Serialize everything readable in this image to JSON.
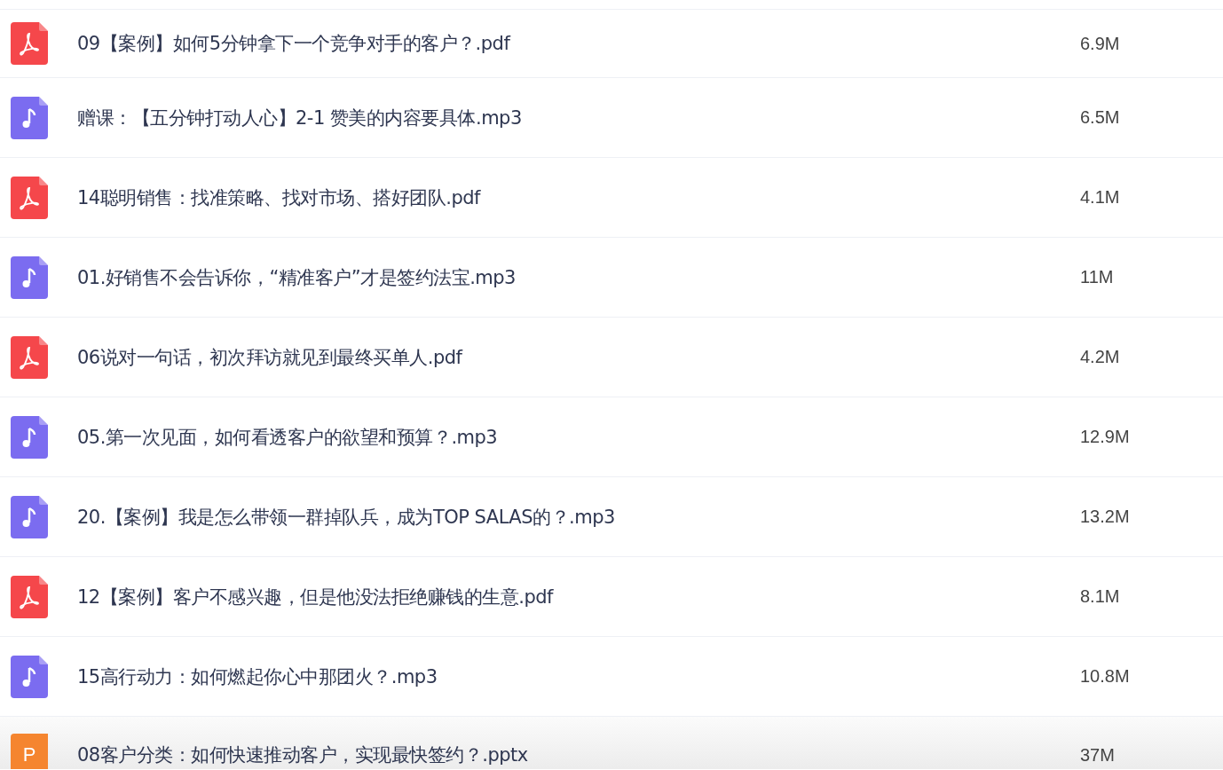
{
  "files": [
    {
      "kind": "pdf",
      "name": "09【案例】如何5分钟拿下一个竞争对手的客户？.pdf",
      "size": "6.9M"
    },
    {
      "kind": "audio",
      "name": "赠课：【五分钟打动人心】2-1 赞美的内容要具体.mp3",
      "size": "6.5M"
    },
    {
      "kind": "pdf",
      "name": "14聪明销售：找准策略、找对市场、搭好团队.pdf",
      "size": "4.1M"
    },
    {
      "kind": "audio",
      "name": "01.好销售不会告诉你，“精准客户”才是签约法宝.mp3",
      "size": "11M"
    },
    {
      "kind": "pdf",
      "name": "06说对一句话，初次拜访就见到最终买单人.pdf",
      "size": "4.2M"
    },
    {
      "kind": "audio",
      "name": "05.第一次见面，如何看透客户的欲望和预算？.mp3",
      "size": "12.9M"
    },
    {
      "kind": "audio",
      "name": "20.【案例】我是怎么带领一群掉队兵，成为TOP SALAS的？.mp3",
      "size": "13.2M"
    },
    {
      "kind": "pdf",
      "name": "12【案例】客户不感兴趣，但是他没法拒绝赚钱的生意.pdf",
      "size": "8.1M"
    },
    {
      "kind": "audio",
      "name": "15高行动力：如何燃起你心中那团火？.mp3",
      "size": "10.8M"
    },
    {
      "kind": "pptx",
      "name": "08客户分类：如何快速推动客户，实现最快签约？.pptx",
      "size": "37M",
      "icon_letter": "P"
    }
  ]
}
